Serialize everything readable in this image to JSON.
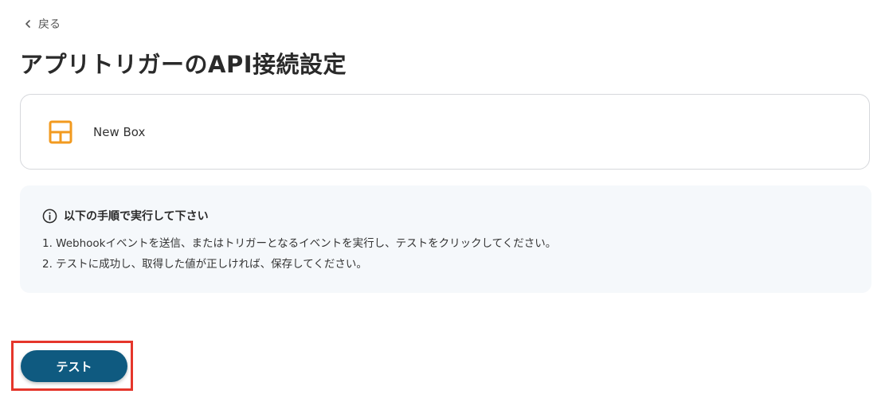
{
  "nav": {
    "back_label": "戻る"
  },
  "page": {
    "title": "アプリトリガーのAPI接続設定"
  },
  "app_card": {
    "icon": "box-layout-icon",
    "name": "New Box"
  },
  "instructions": {
    "icon": "info-icon",
    "heading": "以下の手順で実行して下さい",
    "steps": [
      "1. Webhookイベントを送信、またはトリガーとなるイベントを実行し、テストをクリックしてください。",
      "2. テストに成功し、取得した値が正しければ、保存してください。"
    ]
  },
  "actions": {
    "test_label": "テスト"
  },
  "colors": {
    "primary": "#0f5a80",
    "highlight": "#e5362b",
    "app_icon": "#f29a1f",
    "info_bg": "#f5f8fb"
  }
}
